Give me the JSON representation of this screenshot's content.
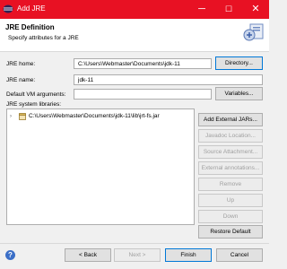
{
  "window": {
    "title": "Add JRE",
    "minimize": "─",
    "maximize": "☐",
    "close": "✕"
  },
  "header": {
    "title": "JRE Definition",
    "subtitle": "Specify attributes for a JRE"
  },
  "form": {
    "jre_home_label": "JRE home:",
    "jre_home_value": "C:\\Users\\Webmaster\\Documents\\jdk-11",
    "directory_button": "Directory...",
    "jre_name_label": "JRE name:",
    "jre_name_value": "jdk-11",
    "vm_args_label": "Default VM arguments:",
    "vm_args_value": "",
    "variables_button": "Variables...",
    "libraries_label": "JRE system libraries:"
  },
  "libraries": [
    {
      "path": "C:\\Users\\Webmaster\\Documents\\jdk-11\\lib\\jrt-fs.jar",
      "expanded": false
    }
  ],
  "side_buttons": {
    "add_external_jars": "Add External JARs...",
    "javadoc_location": "Javadoc Location...",
    "source_attachment": "Source Attachment...",
    "external_annotations": "External annotations...",
    "remove": "Remove",
    "up": "Up",
    "down": "Down",
    "restore_default": "Restore Default"
  },
  "footer": {
    "help": "?",
    "back": "< Back",
    "next": "Next >",
    "finish": "Finish",
    "cancel": "Cancel"
  },
  "colors": {
    "titlebar": "#e81123",
    "accent": "#0078d7"
  }
}
